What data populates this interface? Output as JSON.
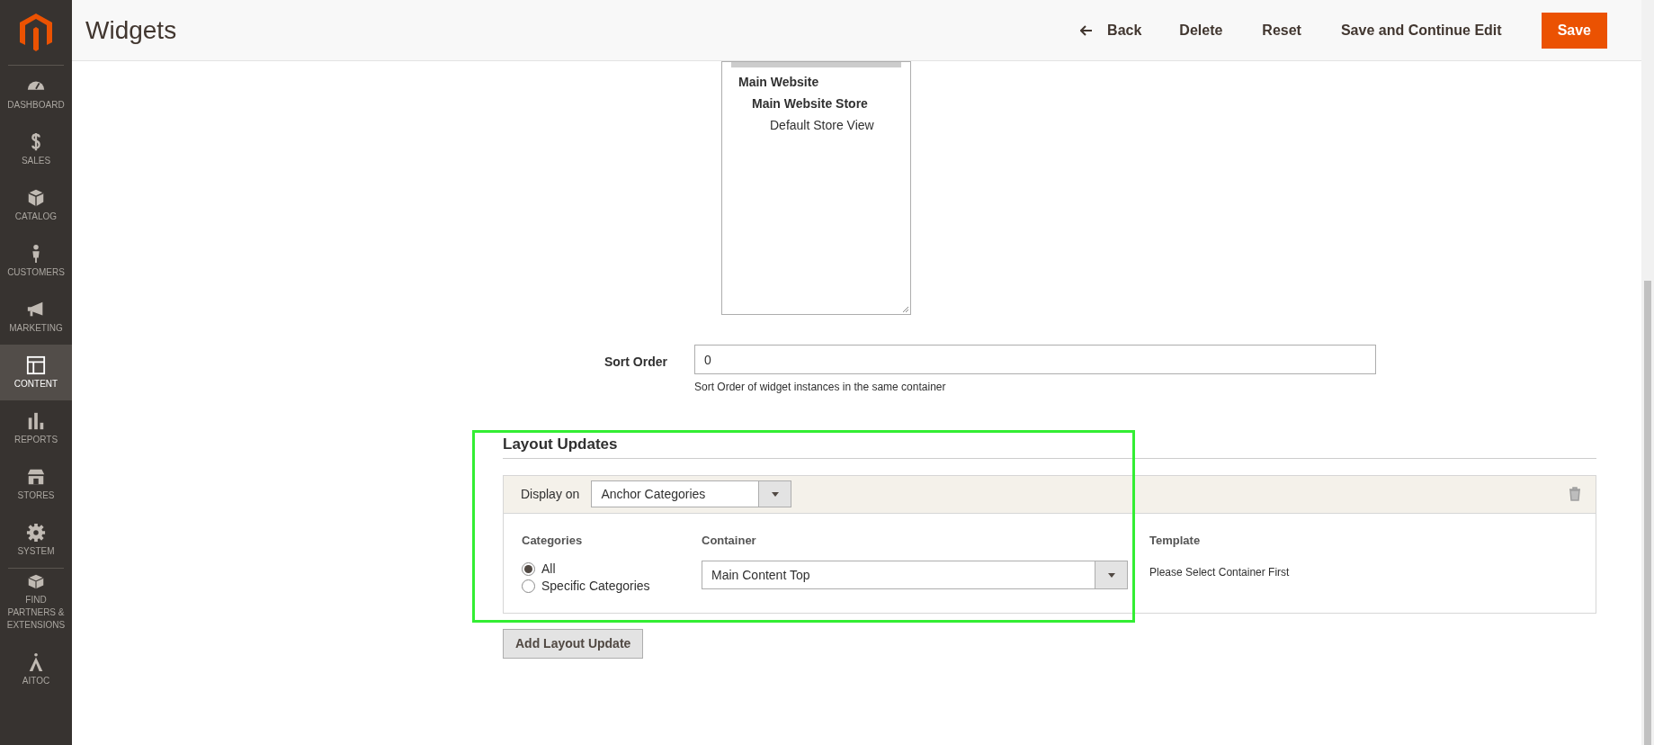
{
  "sidebar": {
    "items": [
      {
        "label": "DASHBOARD",
        "selected": false
      },
      {
        "label": "SALES",
        "selected": false
      },
      {
        "label": "CATALOG",
        "selected": false
      },
      {
        "label": "CUSTOMERS",
        "selected": false
      },
      {
        "label": "MARKETING",
        "selected": false
      },
      {
        "label": "CONTENT",
        "selected": true
      },
      {
        "label": "REPORTS",
        "selected": false
      },
      {
        "label": "STORES",
        "selected": false
      },
      {
        "label": "SYSTEM",
        "selected": false
      },
      {
        "label": "FIND PARTNERS & EXTENSIONS",
        "selected": false
      },
      {
        "label": "AITOC",
        "selected": false
      }
    ]
  },
  "header": {
    "title": "Widgets",
    "actions": [
      {
        "label": "Back",
        "kind": "back"
      },
      {
        "label": "Delete",
        "kind": "plain"
      },
      {
        "label": "Reset",
        "kind": "plain"
      },
      {
        "label": "Save and Continue Edit",
        "kind": "plain"
      },
      {
        "label": "Save",
        "kind": "primary"
      }
    ]
  },
  "store_tree": [
    {
      "label": "Main Website",
      "children": [
        {
          "label": "Main Website Store",
          "children": [
            {
              "label": "Default Store View"
            }
          ]
        }
      ]
    }
  ],
  "sort_order": {
    "label": "Sort Order",
    "value": "0",
    "note": "Sort Order of widget instances in the same container"
  },
  "layout_updates": {
    "title": "Layout Updates",
    "display_on_label": "Display on",
    "display_on": "Anchor Categories",
    "categories_label": "Categories",
    "categories": [
      {
        "label": "All",
        "selected": true
      },
      {
        "label": "Specific Categories",
        "selected": false
      }
    ],
    "container_label": "Container",
    "container": "Main Content Top",
    "template_label": "Template",
    "template_note": "Please Select Container First",
    "add_button": "Add Layout Update"
  }
}
